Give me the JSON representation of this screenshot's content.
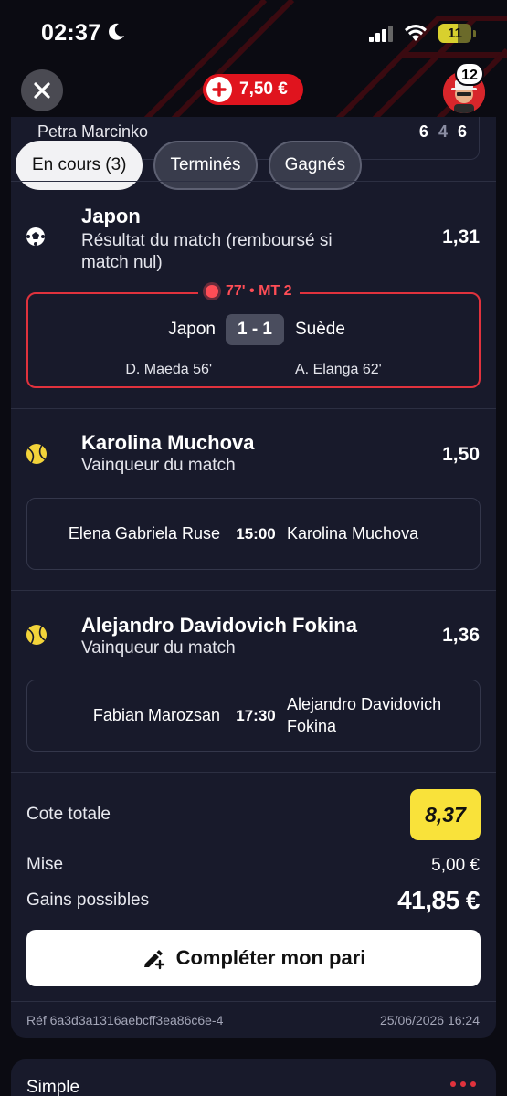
{
  "status_bar": {
    "time": "02:37",
    "battery": "11"
  },
  "header": {
    "balance": "7,50 €",
    "notifications": "12"
  },
  "previous_match": {
    "player": "Petra Marcinko",
    "score_a": "6",
    "score_b": "4",
    "score_c": "6"
  },
  "tabs": [
    {
      "label": "En cours (3)",
      "active": true
    },
    {
      "label": "Terminés",
      "active": false
    },
    {
      "label": "Gagnés",
      "active": false
    }
  ],
  "bets": [
    {
      "icon": "football-icon",
      "selection": "Japon",
      "market": "Résultat du match (remboursé si match nul)",
      "odds": "1,31",
      "live": {
        "status": "77' • MT 2",
        "home": "Japon",
        "score": "1 - 1",
        "away": "Suède",
        "home_scorer": "D. Maeda 56'",
        "away_scorer": "A. Elanga 62'"
      }
    },
    {
      "icon": "tennis-ball-icon",
      "selection": "Karolina Muchova",
      "market": "Vainqueur du match",
      "odds": "1,50",
      "match": {
        "home": "Elena Gabriela Ruse",
        "time": "15:00",
        "away": "Karolina Muchova"
      }
    },
    {
      "icon": "tennis-ball-icon",
      "selection": "Alejandro Davidovich Fokina",
      "market": "Vainqueur du match",
      "odds": "1,36",
      "match": {
        "home": "Fabian Marozsan",
        "time": "17:30",
        "away": "Alejandro Davidovich Fokina"
      }
    }
  ],
  "summary": {
    "total_odds_label": "Cote totale",
    "total_odds": "8,37",
    "stake_label": "Mise",
    "stake": "5,00 €",
    "gains_label": "Gains possibles",
    "gains": "41,85 €",
    "complete_label": "Compléter mon pari",
    "ref": "Réf 6a3d3a1316aebcff3ea86c6e-4",
    "date": "25/06/2026 16:24"
  },
  "next_card": {
    "title": "Simple"
  },
  "colors": {
    "accent_red": "#e0141e",
    "live_red": "#ff4d56",
    "odds_yellow": "#f9e23a",
    "card_bg": "#181a2b"
  }
}
